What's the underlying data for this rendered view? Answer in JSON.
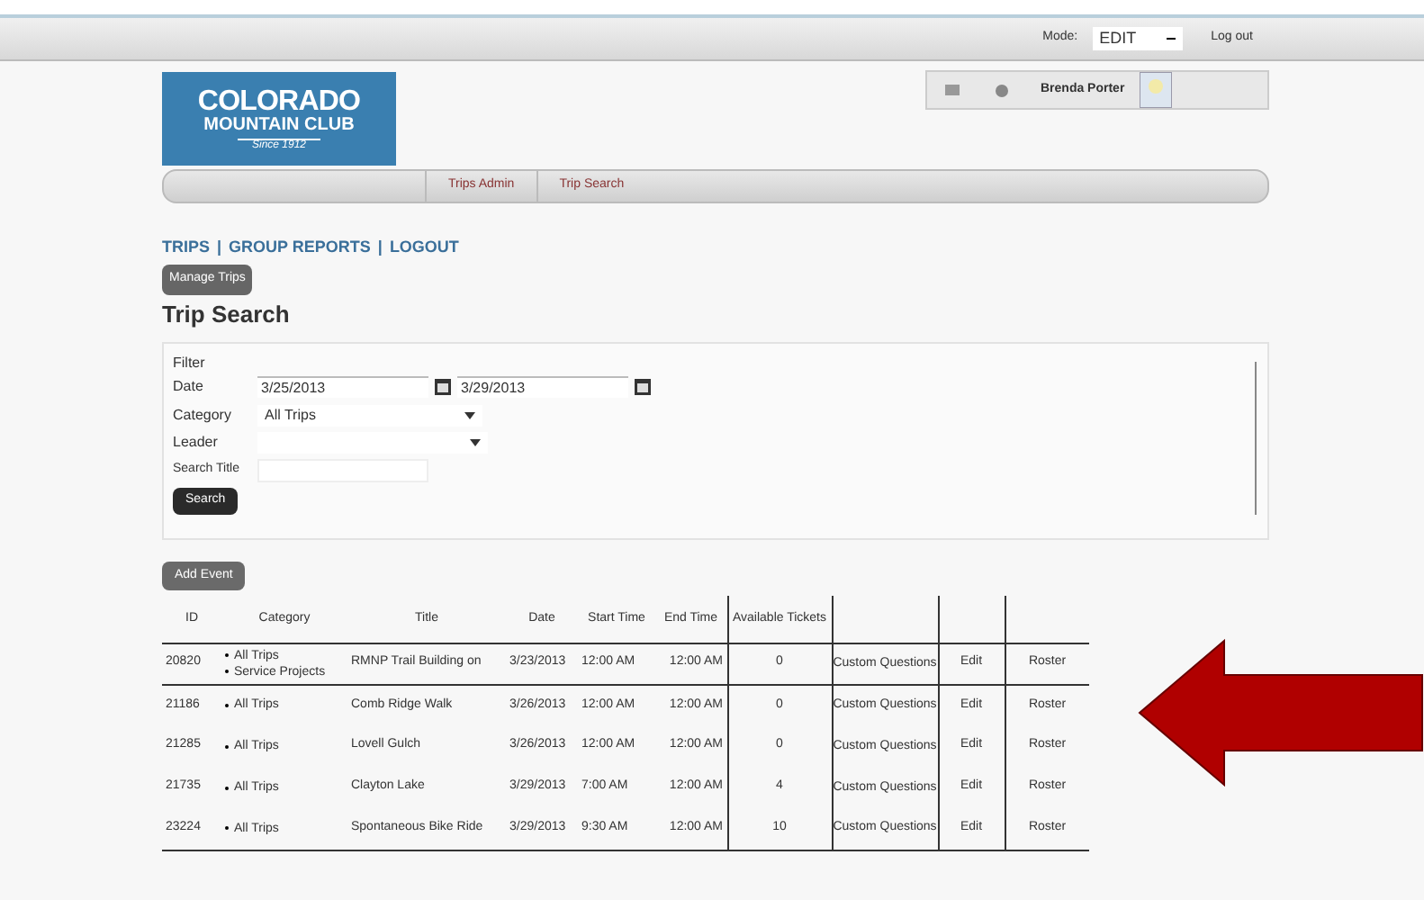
{
  "top_bar": {
    "mode_label": "Mode:",
    "mode_value": "EDIT",
    "logout": "Log out"
  },
  "logo": {
    "line1": "COLORADO",
    "line2": "MOUNTAIN CLUB",
    "line3": "Since 1912"
  },
  "user_bar": {
    "user_name": "Brenda Porter"
  },
  "breadcrumb": [
    "Trips Admin",
    "Trip Search"
  ],
  "nav_links": [
    "TRIPS",
    "GROUP REPORTS",
    "LOGOUT"
  ],
  "nav_separators": [
    "|",
    "|"
  ],
  "manage_button": "Manage Trips",
  "heading": "Trip Search",
  "filter": {
    "title": "Filter",
    "date_label": "Date",
    "date_from": "3/25/2013",
    "date_to": "3/29/2013",
    "category_label": "Category",
    "category_value": "All Trips",
    "leader_label": "Leader",
    "search_title_label": "Search Title",
    "search_button": "Search"
  },
  "add_button": "Add Event",
  "table": {
    "columns": [
      "ID",
      "Category",
      "Title",
      "Date",
      "Start Time",
      "End Time",
      "Available Tickets"
    ],
    "rows": [
      {
        "id": "20820",
        "categories": [
          "All Trips",
          "Service Projects"
        ],
        "title": "RMNP Trail Building on",
        "date": "3/23/2013",
        "start": "12:00 AM",
        "end": "12:00 AM",
        "tickets": "0",
        "questions": "Custom Questions",
        "edit": "Edit",
        "roster": "Roster"
      },
      {
        "id": "21186",
        "categories": [
          "All Trips"
        ],
        "title": "Comb Ridge Walk",
        "date": "3/26/2013",
        "start": "12:00 AM",
        "end": "12:00 AM",
        "tickets": "0",
        "questions": "Custom Questions",
        "edit": "Edit",
        "roster": "Roster"
      },
      {
        "id": "21285",
        "categories": [
          "All Trips"
        ],
        "title": "Lovell Gulch",
        "date": "3/26/2013",
        "start": "12:00 AM",
        "end": "12:00 AM",
        "tickets": "0",
        "questions": "Custom Questions",
        "edit": "Edit",
        "roster": "Roster"
      },
      {
        "id": "21735",
        "categories": [
          "All Trips"
        ],
        "title": "Clayton Lake",
        "date": "3/29/2013",
        "start": "7:00 AM",
        "end": "12:00 AM",
        "tickets": "4",
        "questions": "Custom Questions",
        "edit": "Edit",
        "roster": "Roster"
      },
      {
        "id": "23224",
        "categories": [
          "All Trips"
        ],
        "title": "Spontaneous Bike Ride",
        "date": "3/29/2013",
        "start": "9:30 AM",
        "end": "12:00 AM",
        "tickets": "10",
        "questions": "Custom Questions",
        "edit": "Edit",
        "roster": "Roster"
      }
    ]
  }
}
